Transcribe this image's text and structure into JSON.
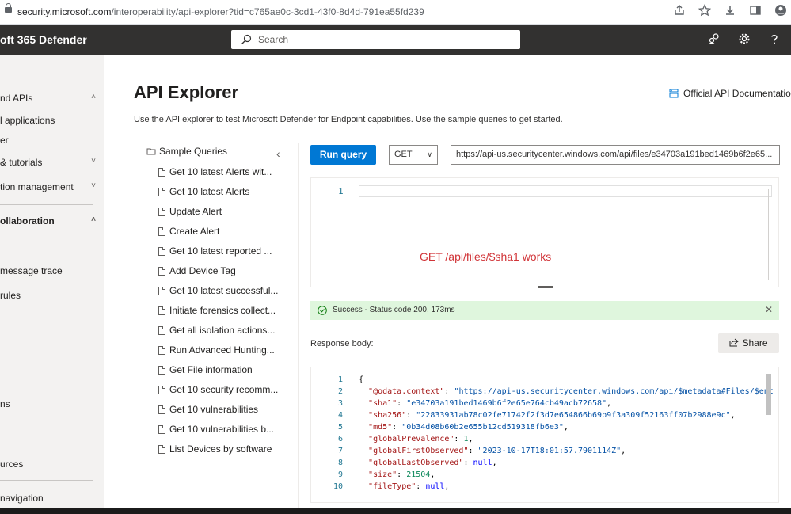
{
  "browser": {
    "url_host": "security.microsoft.com",
    "url_path": "/interoperability/api-explorer?tid=c765ae0c-3cd1-43f0-8d4d-791ea55fd239",
    "icons": [
      "share-icon",
      "star-icon",
      "download-icon",
      "sidebar-icon",
      "profile-icon"
    ]
  },
  "topbar": {
    "brand": "oft 365 Defender",
    "search_placeholder": "Search",
    "icons": [
      "community-icon",
      "settings-icon",
      "help-icon"
    ]
  },
  "leftnav": {
    "items": [
      {
        "label": "nd APIs",
        "chevron": "up"
      },
      {
        "label": "l applications"
      },
      {
        "label": "er"
      },
      {
        "label": "& tutorials",
        "chevron": "down"
      },
      {
        "label": "tion management",
        "chevron": "down"
      },
      {
        "label": "ollaboration",
        "chevron": "up",
        "bold": true
      },
      {
        "label": "message trace"
      },
      {
        "label": "rules"
      },
      {
        "label": "ns"
      },
      {
        "label": "urces"
      },
      {
        "label": " navigation"
      }
    ]
  },
  "page": {
    "title": "API Explorer",
    "doc_link": "Official API Documentation",
    "intro": "Use the API explorer to test Microsoft Defender for Endpoint capabilities. Use the sample queries to get started."
  },
  "sample_queries": {
    "header": "Sample Queries",
    "items": [
      "Get 10 latest Alerts wit...",
      "Get 10 latest Alerts",
      "Update Alert",
      "Create Alert",
      "Get 10 latest reported ...",
      "Add Device Tag",
      "Get 10 latest successful...",
      "Initiate forensics collect...",
      "Get all isolation actions...",
      "Run Advanced Hunting...",
      "Get File information",
      "Get 10 security recomm...",
      "Get 10 vulnerabilities",
      "Get 10 vulnerabilities b...",
      "List Devices by software"
    ]
  },
  "query": {
    "run_label": "Run query",
    "method": "GET",
    "url": "https://api-us.securitycenter.windows.com/api/files/e34703a191bed1469b6f2e65...",
    "editor_line": "1"
  },
  "annotation": "GET /api/files/$sha1 works",
  "status": {
    "text": "Success - Status code 200, 173ms",
    "color": "#dff6dd"
  },
  "response": {
    "label": "Response body:",
    "share_label": "Share",
    "lines": [
      {
        "n": "1",
        "t": "{"
      },
      {
        "n": "2",
        "key": "\"@odata.context\"",
        "val": "\"https://api-us.securitycenter.windows.com/api/$metadata#Files/$ent",
        "vt": "s",
        "comma": false
      },
      {
        "n": "3",
        "key": "\"sha1\"",
        "val": "\"e34703a191bed1469b6f2e65e764cb49acb72658\"",
        "vt": "s",
        "comma": true
      },
      {
        "n": "4",
        "key": "\"sha256\"",
        "val": "\"22833931ab78c02fe71742f2f3d7e654866b69b9f3a309f52163ff07b2988e9c\"",
        "vt": "s",
        "comma": true
      },
      {
        "n": "5",
        "key": "\"md5\"",
        "val": "\"0b34d08b60b2e655b12cd519318fb6e3\"",
        "vt": "s",
        "comma": true
      },
      {
        "n": "6",
        "key": "\"globalPrevalence\"",
        "val": "1",
        "vt": "n",
        "comma": true
      },
      {
        "n": "7",
        "key": "\"globalFirstObserved\"",
        "val": "\"2023-10-17T18:01:57.7901114Z\"",
        "vt": "s",
        "comma": true
      },
      {
        "n": "8",
        "key": "\"globalLastObserved\"",
        "val": "null",
        "vt": "kw",
        "comma": true
      },
      {
        "n": "9",
        "key": "\"size\"",
        "val": "21504",
        "vt": "n",
        "comma": true
      },
      {
        "n": "10",
        "key": "\"fileType\"",
        "val": "null",
        "vt": "kw",
        "comma": true
      }
    ]
  },
  "colors": {
    "accent": "#0078d4",
    "topbar": "#323130",
    "annotation": "#d13438"
  }
}
